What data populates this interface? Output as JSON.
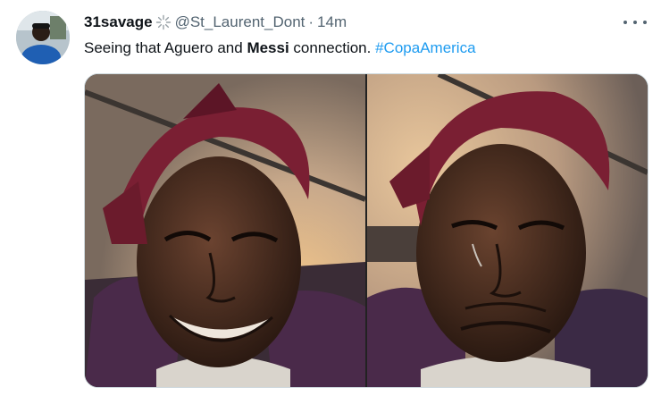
{
  "tweet": {
    "display_name": "31savage",
    "name_emoji_icon": "sparkle-emoji-icon",
    "handle": "@St_Laurent_Dont",
    "separator": "·",
    "time": "14m",
    "more_icon": "more-horizontal-icon",
    "text": {
      "part1": "Seeing that Aguero and ",
      "bold": "Messi",
      "part2": " connection. ",
      "hashtag": "#CopaAmerica"
    },
    "media": [
      {
        "icon": "photo-smiling-man"
      },
      {
        "icon": "photo-crying-man"
      }
    ]
  },
  "colors": {
    "text_primary": "#0f1419",
    "text_secondary": "#536471",
    "link": "#1d9bf0",
    "border": "#cfd9de"
  }
}
